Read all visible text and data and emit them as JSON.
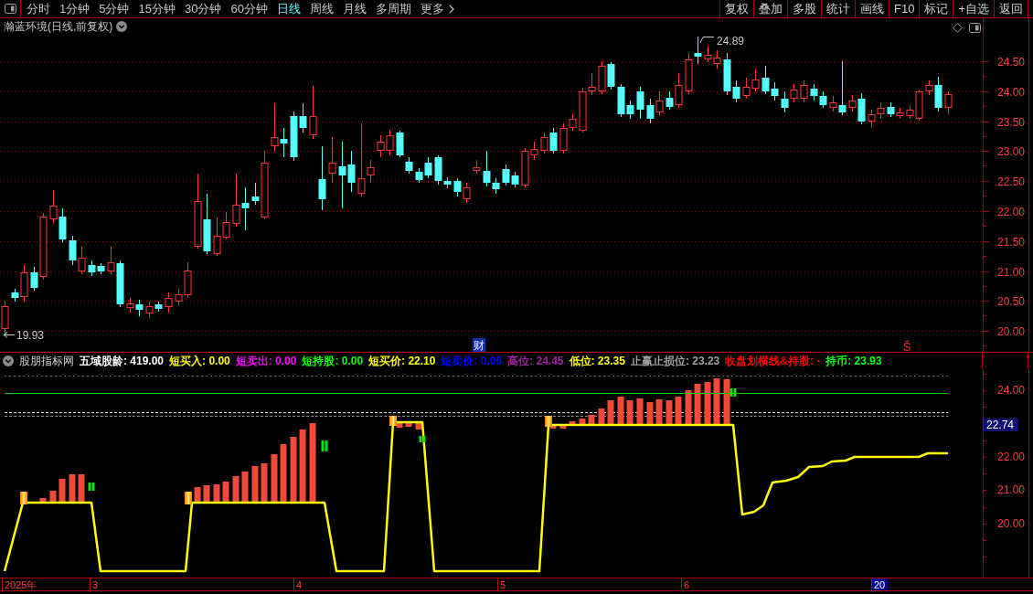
{
  "toolbar": {
    "periods": [
      {
        "label": "分时",
        "selected": false
      },
      {
        "label": "1分钟",
        "selected": false
      },
      {
        "label": "5分钟",
        "selected": false
      },
      {
        "label": "15分钟",
        "selected": false
      },
      {
        "label": "30分钟",
        "selected": false
      },
      {
        "label": "60分钟",
        "selected": false
      },
      {
        "label": "日线",
        "selected": true
      },
      {
        "label": "周线",
        "selected": false
      },
      {
        "label": "月线",
        "selected": false
      },
      {
        "label": "多周期",
        "selected": false
      }
    ],
    "more": "更多",
    "buttons": [
      "复权",
      "叠加",
      "多股",
      "统计",
      "画线",
      "F10",
      "标记",
      "+自选",
      "返回"
    ]
  },
  "price_chart": {
    "title": "瀚蓝环境(日线,前复权)",
    "axis_labels": [
      "24.50",
      "24.00",
      "23.50",
      "23.00",
      "22.50",
      "22.00",
      "21.50",
      "21.00",
      "20.50",
      "20.00"
    ],
    "high_label": "24.89",
    "low_label": "19.93",
    "markers": [
      {
        "kind": "finance",
        "text": "财"
      },
      {
        "kind": "sell",
        "text": "Ŝ"
      }
    ]
  },
  "indicator": {
    "name": "股朋指标网",
    "readouts": [
      {
        "text": "五域股龄: 419.00",
        "color": "#ffffff"
      },
      {
        "text": "短买入: 0.00",
        "color": "#ffff00"
      },
      {
        "text": "短卖出: 0.00",
        "color": "#ff00ff"
      },
      {
        "text": "短持股: 0.00",
        "color": "#00ff00"
      },
      {
        "text": "短买价: 22.10",
        "color": "#ffff00"
      },
      {
        "text": "短卖价: 0.00",
        "color": "#0000ff"
      },
      {
        "text": "高位: 24.45",
        "color": "#a020a0"
      },
      {
        "text": "低位: 23.35",
        "color": "#ffff00"
      },
      {
        "text": "止赢止损位: 23.23",
        "color": "#a0a0a0"
      },
      {
        "text": "收盘划横线&持股: -",
        "color": "#ff0000"
      },
      {
        "text": "持币: 23.93",
        "color": "#00ff00"
      }
    ],
    "axis_labels": [
      "24.00",
      "22.00",
      "21.00",
      "20.00"
    ],
    "current_value": "22.74"
  },
  "time_axis": {
    "labels": [
      {
        "text": "2025年",
        "highlighted": false
      },
      {
        "text": "3",
        "highlighted": false
      },
      {
        "text": "4",
        "highlighted": false
      },
      {
        "text": "5",
        "highlighted": false
      },
      {
        "text": "6",
        "highlighted": false
      },
      {
        "text": "20",
        "highlighted": true
      }
    ]
  }
}
